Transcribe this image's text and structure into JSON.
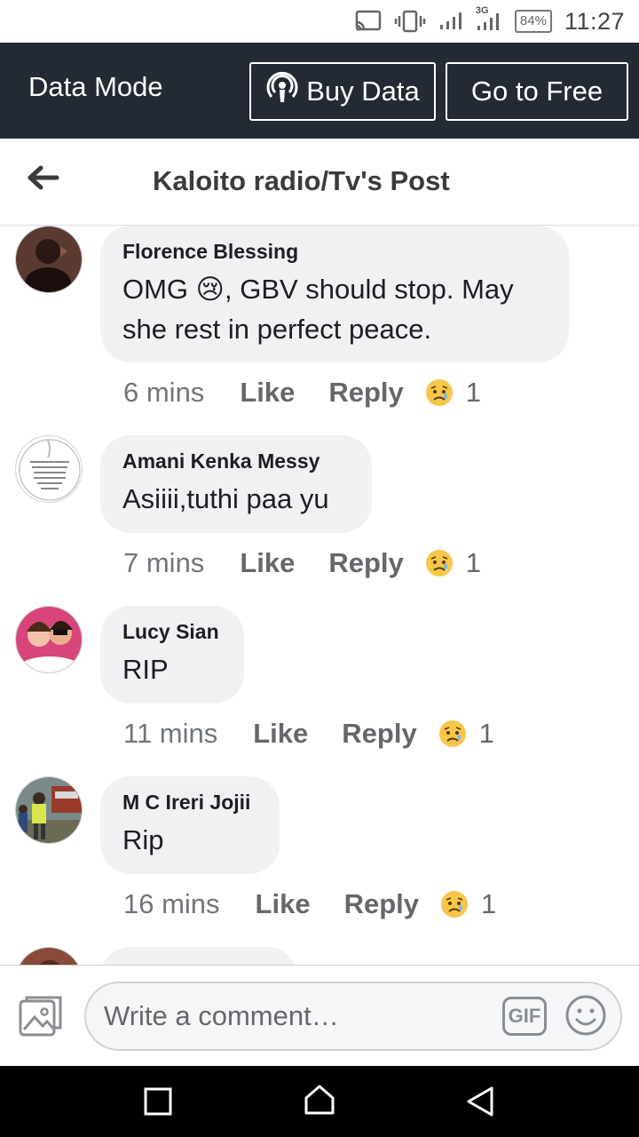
{
  "status_bar": {
    "battery": "84%",
    "time": "11:27",
    "network": "3G"
  },
  "data_mode": {
    "title": "Data Mode",
    "buy_data": "Buy Data",
    "go_to_free": "Go to Free"
  },
  "header": {
    "title": "Kaloito radio/Tv's Post"
  },
  "comments": [
    {
      "author": "Florence Blessing",
      "text": "OMG 😢, GBV should stop. May she rest in perfect peace.",
      "time": "6 mins",
      "like": "Like",
      "reply": "Reply",
      "reactions": "1"
    },
    {
      "author": "Amani Kenka Messy",
      "text": "Asiiii,tuthi paa yu",
      "time": "7 mins",
      "like": "Like",
      "reply": "Reply",
      "reactions": "1"
    },
    {
      "author": "Lucy Sian",
      "text": "RIP",
      "time": "11 mins",
      "like": "Like",
      "reply": "Reply",
      "reactions": "1"
    },
    {
      "author": "M C Ireri Jojii",
      "text": "Rip",
      "time": "16 mins",
      "like": "Like",
      "reply": "Reply",
      "reactions": "1"
    }
  ],
  "composer": {
    "placeholder": "Write a comment…",
    "gif": "GIF"
  },
  "colors": {
    "data_bar": "#232a33",
    "bubble": "#f0f1f3",
    "navbar": "#000000"
  }
}
